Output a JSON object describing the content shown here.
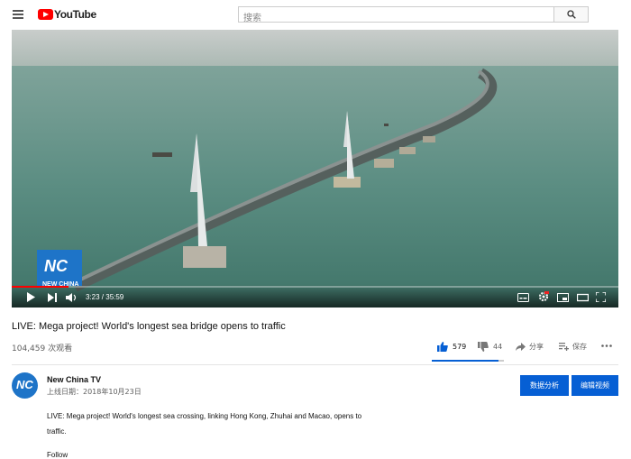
{
  "header": {
    "logo_text": "YouTube",
    "search_placeholder": "搜索"
  },
  "player": {
    "time_current": "3:23",
    "time_total": "35:59",
    "time_display": "3:23 / 35:59",
    "progress_fraction": 0.094,
    "watermark": "NEW CHINA"
  },
  "video": {
    "title": "LIVE: Mega project! World's longest sea bridge opens to traffic",
    "views": "104,459 次观看",
    "likes": "579",
    "dislikes": "44",
    "share_label": "分享",
    "save_label": "保存",
    "like_ratio": 0.93
  },
  "channel": {
    "name": "New China TV",
    "upload_date": "上线日期：2018年10月23日",
    "analytics_button": "数据分析",
    "edit_button": "编辑视频"
  },
  "description": {
    "line1": "LIVE: Mega project! World's longest sea crossing, linking Hong Kong, Zhuhai and Macao, opens to",
    "line2": "traffic.",
    "more": "Follow"
  },
  "colors": {
    "brand_red": "#ff0000",
    "accent_blue": "#065fd4",
    "progress_red": "#ff0000"
  }
}
